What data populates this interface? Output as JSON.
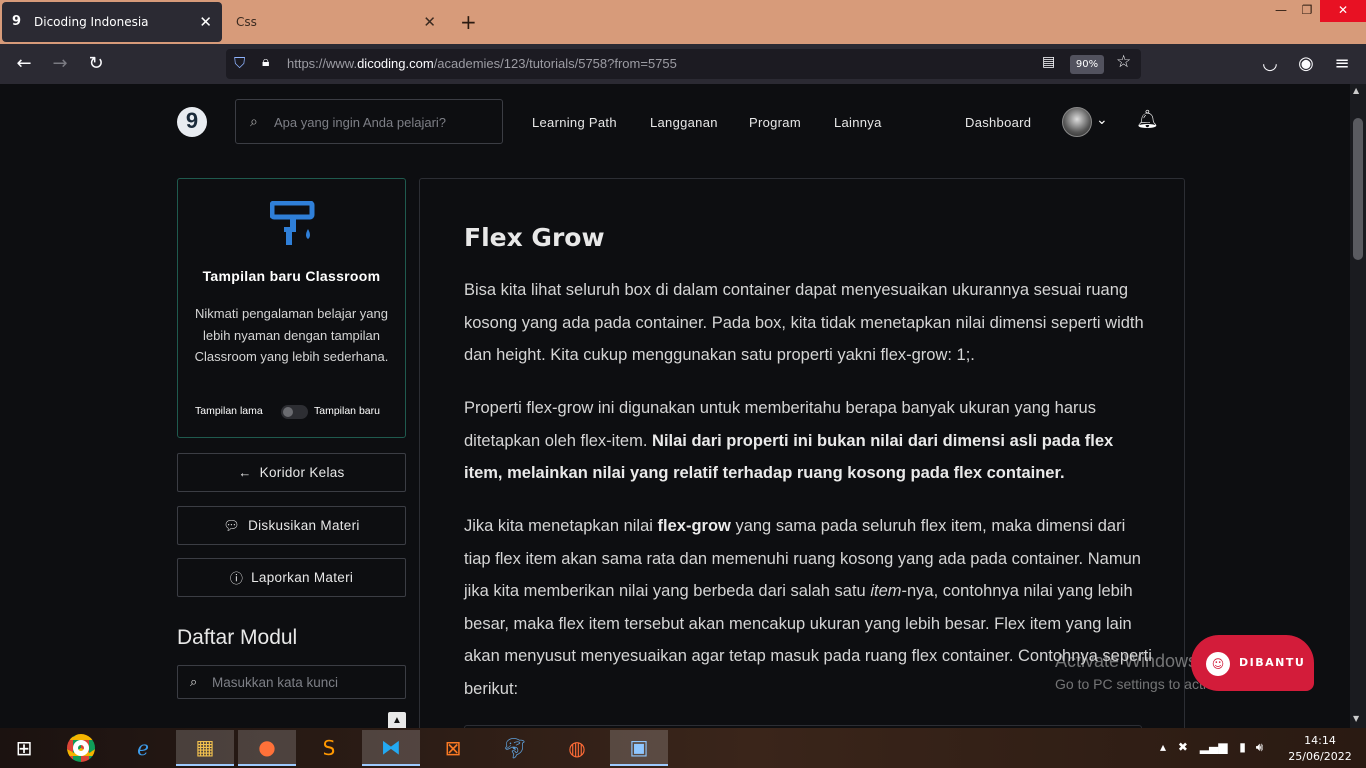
{
  "browser": {
    "tabs": [
      {
        "title": "Dicoding Indonesia",
        "favicon": "9"
      },
      {
        "title": "Css"
      }
    ],
    "url_prefix": "https://www.",
    "url_domain": "dicoding.com",
    "url_path": "/academies/123/tutorials/5758?from=5755",
    "zoom": "90%"
  },
  "site": {
    "logo": "9",
    "search_placeholder": "Apa yang ingin Anda pelajari?",
    "nav": [
      "Learning Path",
      "Langganan",
      "Program",
      "Lainnya"
    ],
    "dashboard": "Dashboard"
  },
  "sidebar": {
    "promo_title": "Tampilan baru Classroom",
    "promo_desc": "Nikmati pengalaman belajar yang lebih nyaman dengan tampilan Classroom yang lebih sederhana.",
    "toggle_old": "Tampilan lama",
    "toggle_new": "Tampilan baru",
    "buttons": [
      "Koridor Kelas",
      "Diskusikan Materi",
      "Laporkan Materi"
    ],
    "modul_title": "Daftar Modul",
    "modul_search_placeholder": "Masukkan kata kunci"
  },
  "content": {
    "title": "Flex Grow",
    "p1": "Bisa kita lihat seluruh box di dalam container dapat menyesuaikan ukurannya sesuai ruang kosong yang ada pada container. Pada box, kita tidak menetapkan nilai dimensi seperti width dan height. Kita cukup menggunakan satu properti yakni flex-grow: 1;.",
    "p2_a": "Properti flex-grow ini digunakan untuk memberitahu berapa banyak ukuran yang harus ditetapkan oleh flex-item. ",
    "p2_b": "Nilai dari properti ini bukan nilai dari dimensi asli pada flex item, melainkan nilai yang relatif terhadap ruang kosong pada flex container.",
    "p3_a": "Jika kita menetapkan nilai ",
    "p3_b": "flex-grow",
    "p3_c": " yang sama pada seluruh flex item, maka dimensi dari tiap flex item akan sama rata dan memenuhi ruang kosong yang ada pada container. Namun jika kita memberikan nilai yang berbeda dari salah satu ",
    "p3_d": "item",
    "p3_e": "-nya, contohnya nilai yang lebih besar, maka flex item tersebut akan mencakup ukuran yang lebih besar. Flex item yang lain akan menyusut menyesuaikan agar tetap masuk pada ruang flex container. Contohnya seperti berikut:"
  },
  "overlay": {
    "watermark_title": "Activate Windows",
    "watermark_sub": "Go to PC settings to activate Windows.",
    "help_label": "DIBANTU"
  },
  "taskbar": {
    "time": "14:14",
    "date": "25/06/2022"
  },
  "colors": {
    "accent": "#d31c3a",
    "page_bg": "#0d0e11",
    "promo_border": "#1f5a4e"
  }
}
